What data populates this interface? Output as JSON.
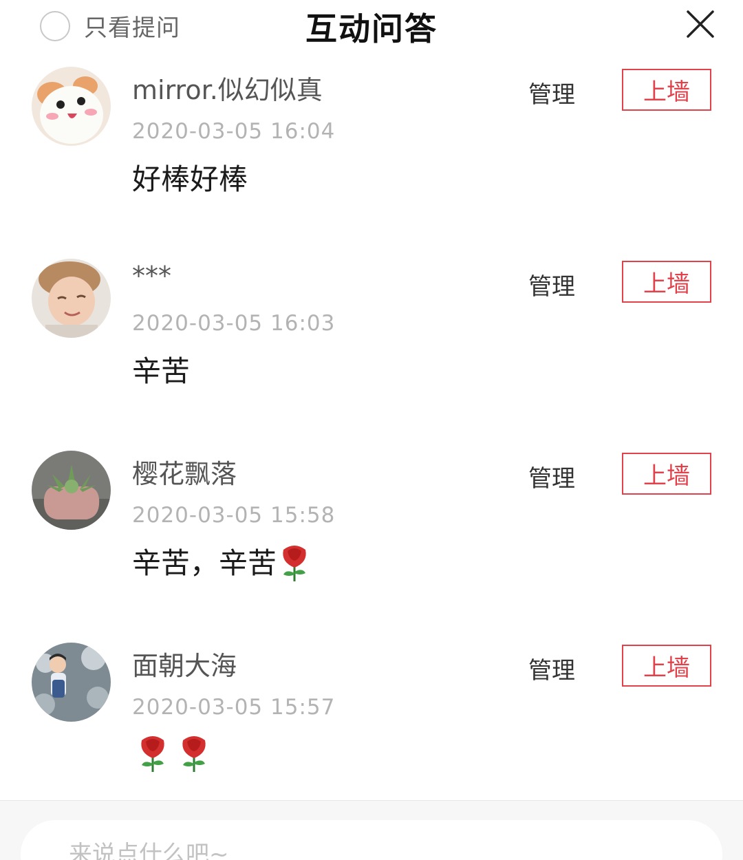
{
  "header": {
    "filter_label": "只看提问",
    "title": "互动问答",
    "close_icon": "close-icon"
  },
  "actions": {
    "manage_label": "管理",
    "wall_label": "上墙"
  },
  "comments": [
    {
      "name": "mirror.似幻似真",
      "time": "2020-03-05 16:04",
      "content": "好棒好棒",
      "avatar": "hamster-avatar",
      "roses": 0
    },
    {
      "name": "***",
      "time": "2020-03-05 16:03",
      "content": "辛苦",
      "avatar": "child-avatar",
      "roses": 0
    },
    {
      "name": "樱花飘落",
      "time": "2020-03-05 15:58",
      "content": "辛苦，辛苦",
      "avatar": "succulent-avatar",
      "roses": 1
    },
    {
      "name": "面朝大海",
      "time": "2020-03-05 15:57",
      "content": "",
      "avatar": "toddler-avatar",
      "roses": 2
    }
  ],
  "footer": {
    "input_placeholder": "来说点什么吧~"
  },
  "colors": {
    "accent": "#e0414b",
    "time_text": "#b3b3b3"
  }
}
